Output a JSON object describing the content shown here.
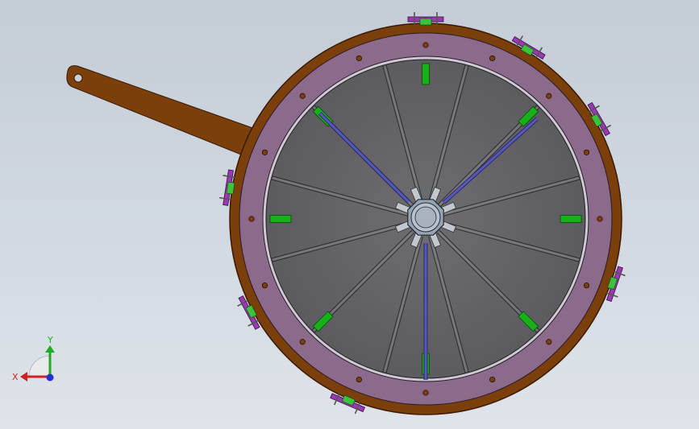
{
  "viewport": {
    "colors": {
      "background_top": "#c4ccd6",
      "background_bottom": "#dfe4ea",
      "outer_ring": "#7a3f0a",
      "flange": "#8b6a8c",
      "disc": "#66666a",
      "hub": "#8c96a2",
      "rod": "#5858b8",
      "green_block": "#18b018",
      "bracket": "#9a3ab0"
    }
  },
  "model": {
    "name_icon": "wheel-assembly-icon",
    "spoke_count": 12,
    "bolt_hole_count": 16,
    "hub_stud_count": 8,
    "rod_count": 3,
    "green_block_count": 8,
    "bracket_count": 7
  },
  "triad": {
    "x_label": "X",
    "y_label": "Y",
    "x_color": "#cc2222",
    "y_color": "#22aa22",
    "z_color": "#2233cc"
  }
}
